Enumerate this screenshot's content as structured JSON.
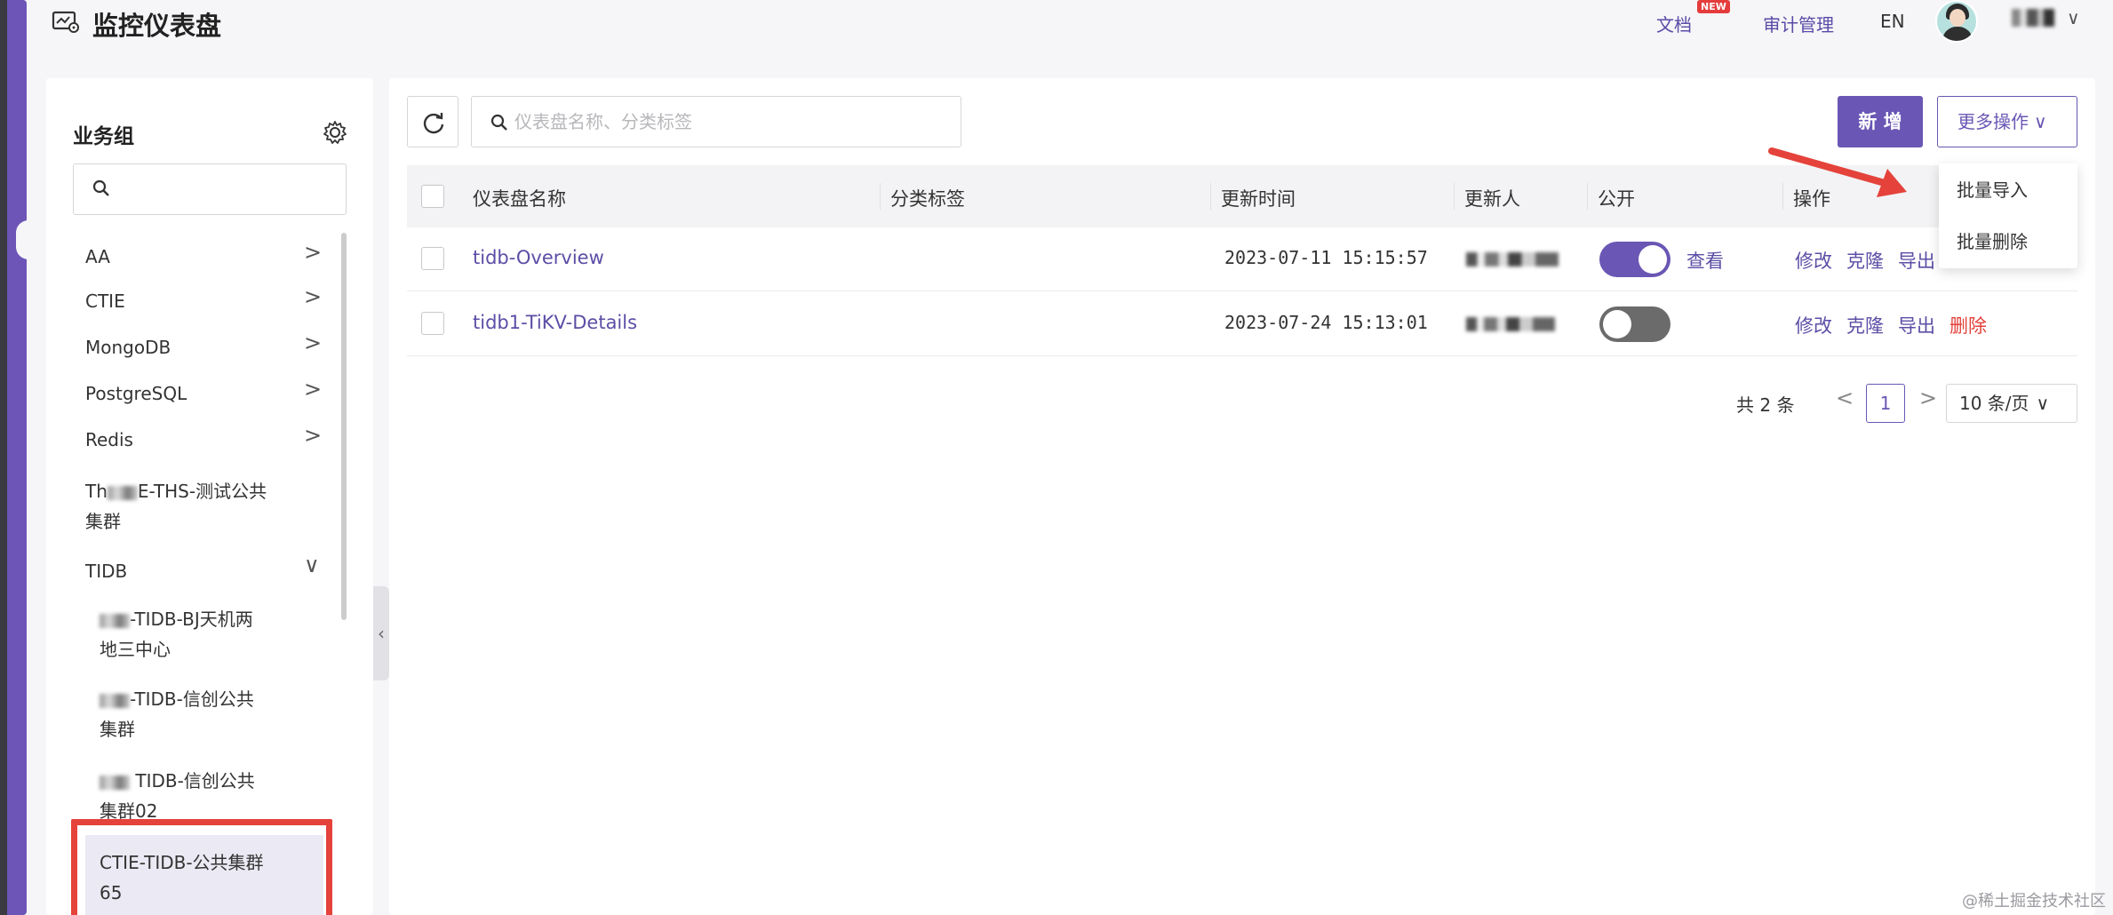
{
  "header": {
    "title": "监控仪表盘",
    "docs_label": "文档",
    "new_badge": "NEW",
    "audit_label": "审计管理",
    "lang_label": "EN",
    "caret": "∨"
  },
  "sidebar": {
    "title": "业务组",
    "search_placeholder": "",
    "items": [
      {
        "label": "AA",
        "chevron": ">"
      },
      {
        "label": "CTIE",
        "chevron": ">"
      },
      {
        "label": "MongoDB",
        "chevron": ">"
      },
      {
        "label": "PostgreSQL",
        "chevron": ">"
      },
      {
        "label": "Redis",
        "chevron": ">"
      },
      {
        "label_prefix": "Th",
        "label": "E-THS-测试公共",
        "label_line2": "集群"
      },
      {
        "label": "TIDB",
        "chevron": "∨"
      }
    ],
    "sub_items": [
      {
        "label": "-TIDB-BJ天机两",
        "label_line2": "地三中心"
      },
      {
        "label": "-TIDB-信创公共",
        "label_line2": "集群"
      },
      {
        "label": " TIDB-信创公共",
        "label_line2": "集群02"
      },
      {
        "label": "CTIE-TIDB-公共集群",
        "label_line2": "65"
      }
    ],
    "collapse_icon": "‹"
  },
  "toolbar": {
    "search_placeholder": "仪表盘名称、分类标签",
    "new_label": "新 增",
    "more_label": "更多操作",
    "more_caret": "∨"
  },
  "table": {
    "headers": [
      "仪表盘名称",
      "分类标签",
      "更新时间",
      "更新人",
      "公开",
      "操作"
    ],
    "rows": [
      {
        "name": "tidb-Overview",
        "tags": "",
        "updated": "2023-07-11 15:15:57",
        "public": true,
        "view_label": "查看",
        "ops": [
          "修改",
          "克隆",
          "导出"
        ]
      },
      {
        "name": "tidb1-TiKV-Details",
        "tags": "",
        "updated": "2023-07-24 15:13:01",
        "public": false,
        "ops": [
          "修改",
          "克隆",
          "导出",
          "删除"
        ]
      }
    ]
  },
  "pagination": {
    "total_label": "共 2 条",
    "current_page": "1",
    "page_size_label": "10 条/页",
    "prev": "<",
    "next": ">",
    "size_caret": "∨"
  },
  "dropdown": {
    "items": [
      "批量导入",
      "批量删除"
    ]
  },
  "watermark": "@稀土掘金技术社区",
  "colors": {
    "accent": "#6a56b4",
    "danger": "#e4423b",
    "annotation_red": "#e4423b"
  }
}
